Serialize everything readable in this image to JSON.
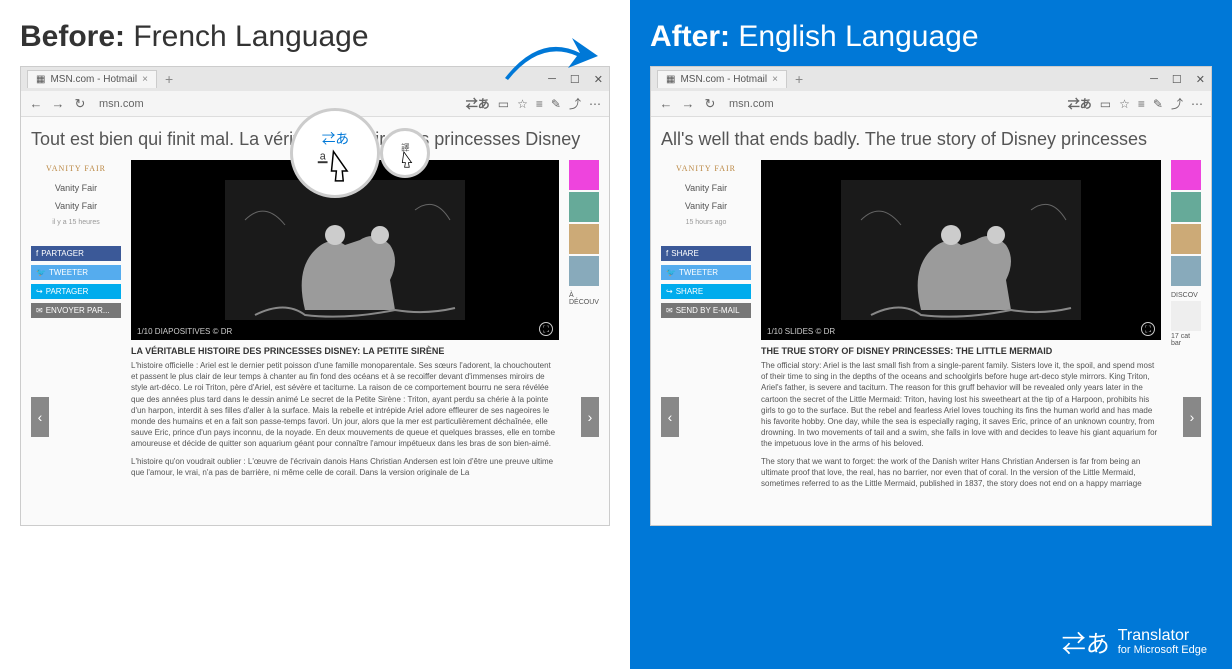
{
  "labels": {
    "before_prefix": "Before:",
    "before_lang": " French Language",
    "after_prefix": "After:",
    "after_lang": " English Language"
  },
  "branding": {
    "name": "Translator",
    "sub": "for Microsoft Edge"
  },
  "before": {
    "tab_title": "MSN.com - Hotmail",
    "url": "msn.com",
    "page_title": "Tout est bien qui finit mal. La véritable histoire des princesses Disney",
    "attribution": "VANITY FAIR",
    "source": "Vanity Fair",
    "source_sub": "Vanity Fair",
    "time": "il y a 15 heures",
    "share_fb": "PARTAGER",
    "share_tw": "TWEETER",
    "share_sh": "PARTAGER",
    "share_em": "ENVOYER PAR...",
    "img_caption": "1/10 DIAPOSITIVES  © DR",
    "article_h": "LA VÉRITABLE HISTOIRE DES PRINCESSES DISNEY: LA PETITE SIRÈNE",
    "article_p1": "L'histoire officielle : Ariel est le dernier petit poisson d'une famille monoparentale. Ses sœurs l'adorent, la chouchoutent et passent le plus clair de leur temps à chanter au fin fond des océans et à se recoiffer devant d'immenses miroirs de style art-déco. Le roi Triton, père d'Ariel, est sévère et taciturne. La raison de ce comportement bourru ne sera révélée que des années plus tard dans le dessin animé Le secret de la Petite Sirène : Triton, ayant perdu sa chérie à la pointe d'un harpon, interdit à ses filles d'aller à la surface. Mais la rebelle et intrépide Ariel adore effleurer de ses nageoires le monde des humains et en a fait son passe-temps favori. Un jour, alors que la mer est particulièrement déchaînée, elle sauve Eric, prince d'un pays inconnu, de la noyade. En deux mouvements de queue et quelques brasses, elle en tombe amoureuse et décide de quitter son aquarium géant pour connaître l'amour impétueux dans les bras de son bien-aimé.",
    "article_p2": "L'histoire qu'on voudrait oublier : L'œuvre de l'écrivain danois Hans Christian Andersen est loin d'être une preuve ultime que l'amour, le vrai, n'a pas de barrière, ni même celle de corail. Dans la version originale de La",
    "discover": "À DÉCOUV"
  },
  "after": {
    "tab_title": "MSN.com - Hotmail",
    "url": "msn.com",
    "page_title": "All's well that ends badly. The true story of Disney princesses",
    "attribution": "VANITY FAIR",
    "source": "Vanity Fair",
    "source_sub": "Vanity Fair",
    "time": "15 hours ago",
    "share_fb": "SHARE",
    "share_tw": "TWEETER",
    "share_sh": "SHARE",
    "share_em": "SEND BY E-MAIL",
    "img_caption": "1/10 SLIDES  © DR",
    "article_h": "THE TRUE STORY OF DISNEY PRINCESSES: THE LITTLE MERMAID",
    "article_p1": "The official story: Ariel is the last small fish from a single-parent family. Sisters love it, the spoil, and spend most of their time to sing in the depths of the oceans and schoolgirls before huge art-deco style mirrors. King Triton, Ariel's father, is severe and taciturn. The reason for this gruff behavior will be revealed only years later in the cartoon the secret of the Little Mermaid: Triton, having lost his sweetheart at the tip of a Harpoon, prohibits his girls to go to the surface. But the rebel and fearless Ariel loves touching its fins the human world and has made his favorite hobby. One day, while the sea is especially raging, it saves Eric, prince of an unknown country, from drowning. In two movements of tail and a swim, she falls in love with and decides to leave his giant aquarium for the impetuous love in the arms of his beloved.",
    "article_p2": "The story that we want to forget: the work of the Danish writer Hans Christian Andersen is far from being an ultimate proof that love, the real, has no barrier, nor even that of coral. In the version of the Little Mermaid, sometimes referred to as the Little Mermaid, published in 1837, the story does not end on a happy marriage",
    "discover": "DISCOV",
    "side_text": "17 cat bar"
  }
}
